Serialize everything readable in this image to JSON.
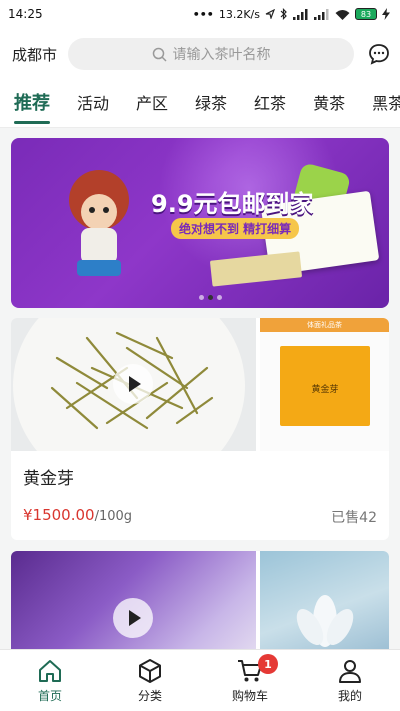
{
  "status_bar": {
    "time": "14:25",
    "dots": "•••",
    "speed": "13.2K/s",
    "battery": "83"
  },
  "header": {
    "city": "成都市",
    "search_placeholder": "请输入茶叶名称"
  },
  "tabs": [
    {
      "label": "推荐",
      "active": true
    },
    {
      "label": "活动"
    },
    {
      "label": "产区"
    },
    {
      "label": "绿茶"
    },
    {
      "label": "红茶"
    },
    {
      "label": "黄茶"
    },
    {
      "label": "黑茶"
    }
  ],
  "banner": {
    "title": "9.9元包邮到家",
    "subtitle": "绝对想不到 精打细算"
  },
  "products": [
    {
      "name": "黄金芽",
      "price": "¥1500.00",
      "unit": "/100g",
      "sold": "已售42",
      "side_bar": "体面礼品茶",
      "bag_text": "黄金芽"
    }
  ],
  "bottom_nav": [
    {
      "label": "首页",
      "active": true,
      "icon": "home-icon"
    },
    {
      "label": "分类",
      "icon": "box-icon"
    },
    {
      "label": "购物车",
      "icon": "cart-icon",
      "badge": "1"
    },
    {
      "label": "我的",
      "icon": "user-icon"
    }
  ],
  "colors": {
    "accent": "#1f6b55",
    "price": "#d9362f",
    "badge": "#e53935",
    "banner_bg": "#8e37c9"
  }
}
